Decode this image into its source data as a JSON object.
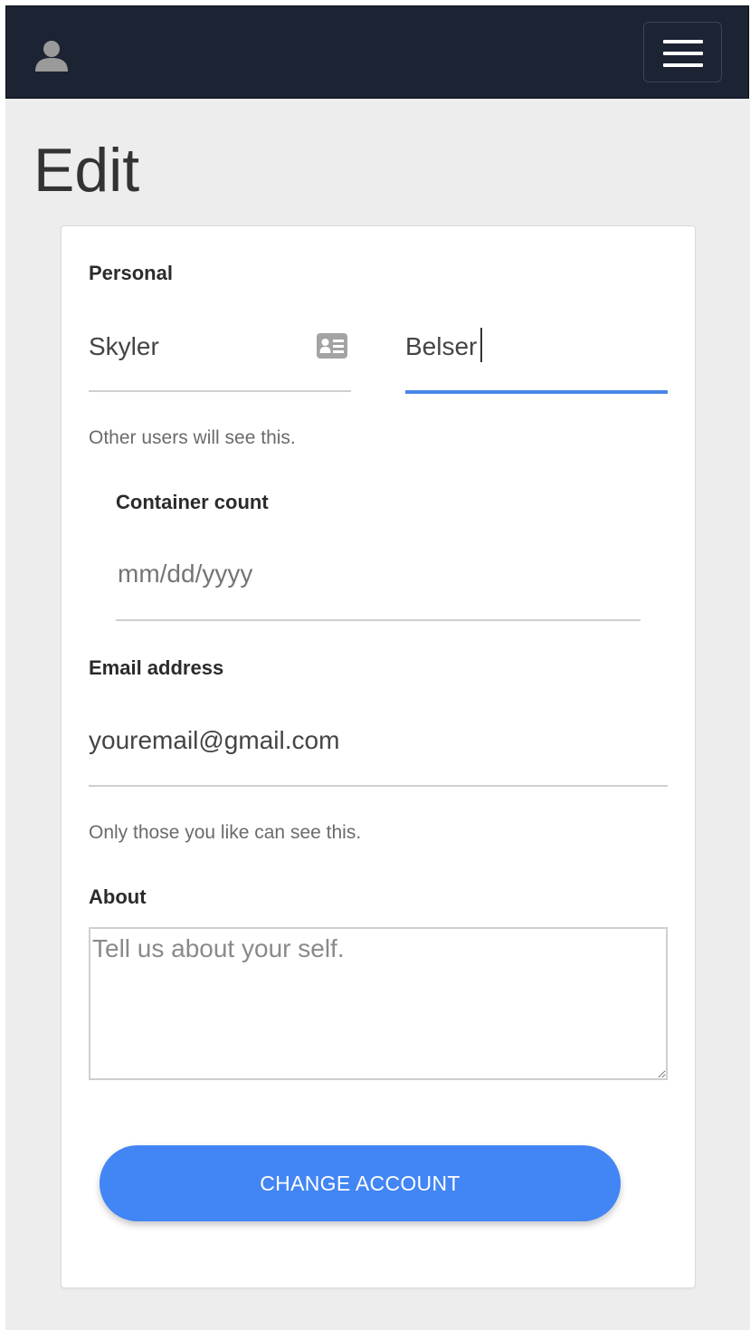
{
  "navbar": {
    "user_icon": "user-icon",
    "menu_icon": "hamburger-menu-icon"
  },
  "page": {
    "title": "Edit"
  },
  "form": {
    "personal": {
      "label": "Personal",
      "first_name_value": "Skyler",
      "first_name_icon": "contact-card-icon",
      "last_name_value": "Belser",
      "help": "Other users will see this."
    },
    "container_count": {
      "label": "Container count",
      "placeholder": "mm/dd/yyyy"
    },
    "email": {
      "label": "Email address",
      "value": "youremail@gmail.com",
      "help": "Only those you like can see this."
    },
    "about": {
      "label": "About",
      "placeholder": "Tell us about your self."
    },
    "submit_label": "CHANGE ACCOUNT"
  },
  "colors": {
    "navbar": "#1c2333",
    "accent": "#4285f4",
    "background": "#ededed"
  }
}
